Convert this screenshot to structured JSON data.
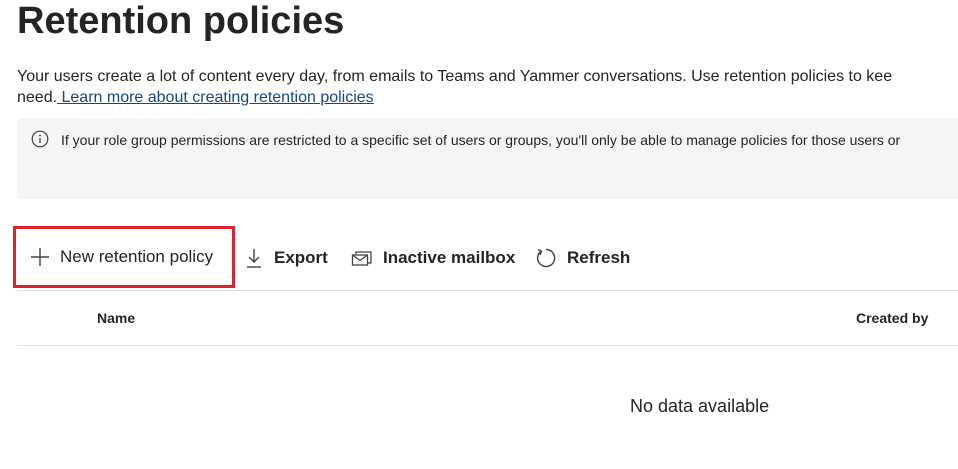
{
  "page": {
    "title": "Retention policies",
    "description_line1": "Your users create a lot of content every day, from emails to Teams and Yammer conversations. Use retention policies to kee",
    "description_line2_prefix": "need.",
    "learn_more_link": " Learn more about creating retention policies"
  },
  "info_banner": {
    "icon": "info-icon",
    "text": "If your role group permissions are restricted to a specific set of users or groups, you'll only be able to manage policies for those users or"
  },
  "toolbar": {
    "new_policy_label": "New retention policy",
    "new_policy_icon": "plus-icon",
    "export_label": "Export",
    "export_icon": "download-icon",
    "inactive_mailbox_label": "Inactive mailbox",
    "inactive_mailbox_icon": "mail-icon",
    "refresh_label": "Refresh",
    "refresh_icon": "refresh-icon",
    "highlight_color": "#e0202b"
  },
  "table": {
    "columns": [
      "Name",
      "Created by"
    ],
    "empty_message": "No data available"
  }
}
